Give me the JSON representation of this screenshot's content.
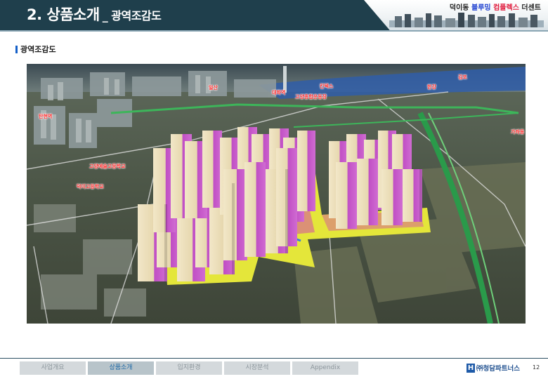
{
  "header": {
    "title": "2. 상품소개",
    "subtitle": "_ 광역조감도",
    "brand_part1": "덕이동",
    "brand_part2": "블루밍",
    "brand_part3": "컴플렉스",
    "brand_part4": "더센트"
  },
  "section": {
    "title": "광역조감도"
  },
  "photo": {
    "labels": [
      "일산",
      "대화역",
      "킨텍스",
      "고양종합운동장",
      "한강",
      "김포",
      "탄현역",
      "가좌동",
      "고양예술고등학교",
      "덕이고등학교"
    ]
  },
  "footer": {
    "tabs": [
      "사업개요",
      "상품소개",
      "입지환경",
      "시장분석",
      "Appendix"
    ],
    "active_tab": "상품소개",
    "company": "㈜청담파트너스",
    "logo_letter": "H",
    "page_number": "12"
  },
  "colors": {
    "header_bg": "#1f3f4c",
    "accent_blue": "#1560c8",
    "label_red": "#ff2b2b",
    "tab_active_text": "#1f6aa8"
  }
}
